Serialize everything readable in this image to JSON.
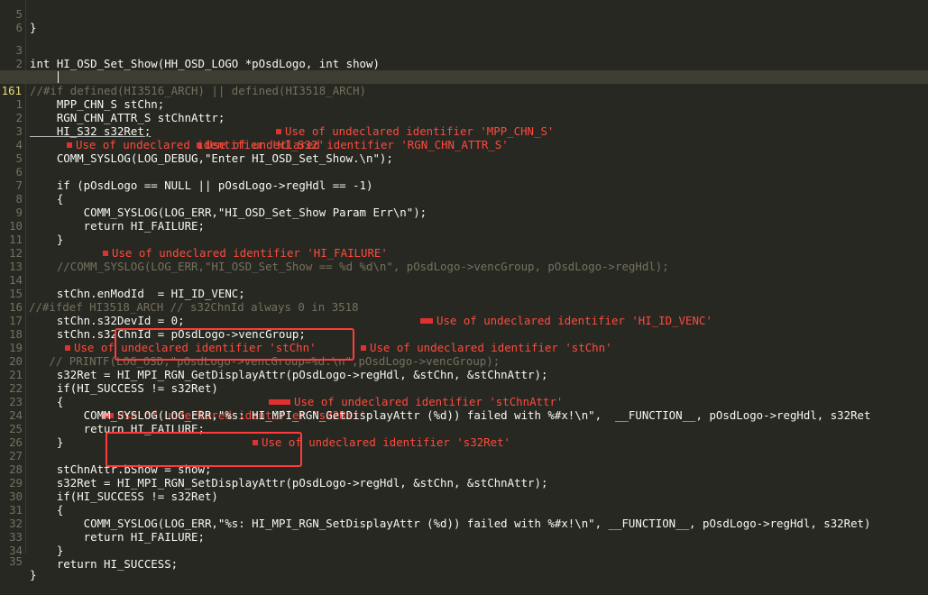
{
  "editor": {
    "lines": [
      {
        "ln": "5",
        "text": "}"
      },
      {
        "ln": "6",
        "text": ""
      },
      {
        "ln": "3",
        "text": "int HI_OSD_Set_Show(HH_OSD_LOGO *pOsdLogo, int show)"
      },
      {
        "ln": "2",
        "text": "{"
      },
      {
        "ln": "1",
        "text": "//#if defined(HI3516_ARCH) || defined(HI3518_ARCH)"
      },
      {
        "ln": "161",
        "text": "    MPP_CHN_S stChn;"
      },
      {
        "ln": "1",
        "text": "    RGN_CHN_ATTR_S stChnAttr;",
        "error": "Use of undeclared identifier 'MPP_CHN_S'"
      },
      {
        "ln": "2",
        "text": "    HI_S32 s32Ret;",
        "error": "Use of undeclared identifier 'RGN_CHN_ATTR_S'"
      },
      {
        "ln": "3",
        "text": "",
        "error": "Use of undeclared identifier 'HI_S32'"
      },
      {
        "ln": "4",
        "text": "    COMM_SYSLOG(LOG_DEBUG,\"Enter HI_OSD_Set_Show.\\n\");"
      },
      {
        "ln": "5",
        "text": ""
      },
      {
        "ln": "6",
        "text": "    if (pOsdLogo == NULL || pOsdLogo->regHdl == -1)"
      },
      {
        "ln": "7",
        "text": "    {"
      },
      {
        "ln": "8",
        "text": "        COMM_SYSLOG(LOG_ERR,\"HI_OSD_Set_Show Param Err\\n\");"
      },
      {
        "ln": "9",
        "text": "        return HI_FAILURE;"
      },
      {
        "ln": "10",
        "text": "    }",
        "error": "Use of undeclared identifier 'HI_FAILURE'"
      },
      {
        "ln": "11",
        "text": ""
      },
      {
        "ln": "12",
        "text": "    //COMM_SYSLOG(LOG_ERR,\"HI_OSD_Set_Show == %d %d\\n\", pOsdLogo->vencGroup, pOsdLogo->regHdl);"
      },
      {
        "ln": "13",
        "text": ""
      },
      {
        "ln": "14",
        "text": "    stChn.enModId  = HI_ID_VENC;"
      },
      {
        "ln": "15",
        "text": "//#ifdef HI3518_ARCH // s32ChnId always 0 in 3518",
        "error": "Use of undeclared identifier 'HI_ID_VENC'"
      },
      {
        "ln": "16",
        "text": "    stChn.s32DevId = 0;"
      },
      {
        "ln": "17",
        "text": "    stChn.s32ChnId = pOsdLogo->vencGroup;",
        "error": "Use of undeclared identifier 'stChn'"
      },
      {
        "ln": "18",
        "text": "",
        "error": "Use of undeclared identifier 'stChn'"
      },
      {
        "ln": "19",
        "text": "   // PRINTF(LOG_OSD,\"pOsdLogo->vencGroup=%d.\\n\",pOsdLogo->vencGroup);"
      },
      {
        "ln": "20",
        "text": "    s32Ret = HI_MPI_RGN_GetDisplayAttr(pOsdLogo->regHdl, &stChn, &stChnAttr);"
      },
      {
        "ln": "21",
        "text": "    if(HI_SUCCESS != s32Ret)",
        "error": "Use of undeclared identifier 'stChnAttr'"
      },
      {
        "ln": "22",
        "text": "    {",
        "error": "Use of undeclared identifier 's32Ret'"
      },
      {
        "ln": "23",
        "text": "        COMM_SYSLOG(LOG_ERR,\"%s: HI_MPI_RGN_GetDisplayAttr (%d)) failed with %#x!\\n\",  __FUNCTION__, pOsdLogo->regHdl, s32Ret"
      },
      {
        "ln": "24",
        "text": "        return HI_FAILURE;",
        "error": "Use of undeclared identifier 's32Ret'"
      },
      {
        "ln": "25",
        "text": "    }"
      },
      {
        "ln": "26",
        "text": ""
      },
      {
        "ln": "27",
        "text": "    stChnAttr.bShow = show;"
      },
      {
        "ln": "28",
        "text": "    s32Ret = HI_MPI_RGN_SetDisplayAttr(pOsdLogo->regHdl, &stChn, &stChnAttr);"
      },
      {
        "ln": "29",
        "text": "    if(HI_SUCCESS != s32Ret)"
      },
      {
        "ln": "30",
        "text": "    {"
      },
      {
        "ln": "31",
        "text": "        COMM_SYSLOG(LOG_ERR,\"%s: HI_MPI_RGN_SetDisplayAttr (%d)) failed with %#x!\\n\", __FUNCTION__, pOsdLogo->regHdl, s32Ret)"
      },
      {
        "ln": "32",
        "text": "        return HI_FAILURE;"
      },
      {
        "ln": "33",
        "text": "    }"
      },
      {
        "ln": "34",
        "text": "    return HI_SUCCESS;"
      },
      {
        "ln": "35",
        "text": "}"
      }
    ]
  },
  "colors": {
    "background": "#272822",
    "current_line": "#3e3d32",
    "error": "#ff4a3d",
    "highlight_box": "#ff3b3b",
    "macro": "#66d9ef",
    "number": "#ae81ff",
    "comment": "#75715e"
  }
}
